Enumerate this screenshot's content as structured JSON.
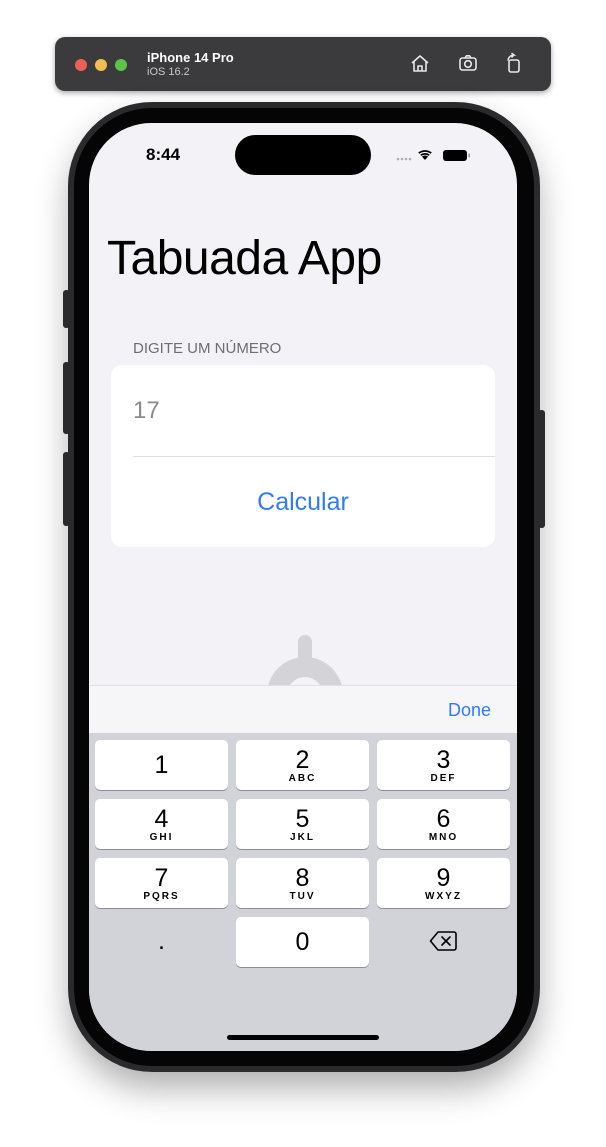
{
  "simulator": {
    "device": "iPhone 14 Pro",
    "os": "iOS 16.2",
    "icons": [
      "home-icon",
      "screenshot-icon",
      "rotate-icon"
    ]
  },
  "status_bar": {
    "time": "8:44"
  },
  "app": {
    "title": "Tabuada App",
    "section_header": "DIGITE UM NÚMERO",
    "input_value": "17",
    "input_placeholder": "17",
    "calculate_label": "Calcular"
  },
  "keyboard": {
    "toolbar_done": "Done",
    "keys": [
      {
        "digit": "1",
        "letters": ""
      },
      {
        "digit": "2",
        "letters": "ABC"
      },
      {
        "digit": "3",
        "letters": "DEF"
      },
      {
        "digit": "4",
        "letters": "GHI"
      },
      {
        "digit": "5",
        "letters": "JKL"
      },
      {
        "digit": "6",
        "letters": "MNO"
      },
      {
        "digit": "7",
        "letters": "PQRS"
      },
      {
        "digit": "8",
        "letters": "TUV"
      },
      {
        "digit": "9",
        "letters": "WXYZ"
      },
      {
        "digit": ".",
        "letters": ""
      },
      {
        "digit": "0",
        "letters": ""
      }
    ]
  },
  "colors": {
    "accent": "#2f7cf6",
    "background": "#f2f2f7",
    "keyboard": "#d1d3d9"
  }
}
